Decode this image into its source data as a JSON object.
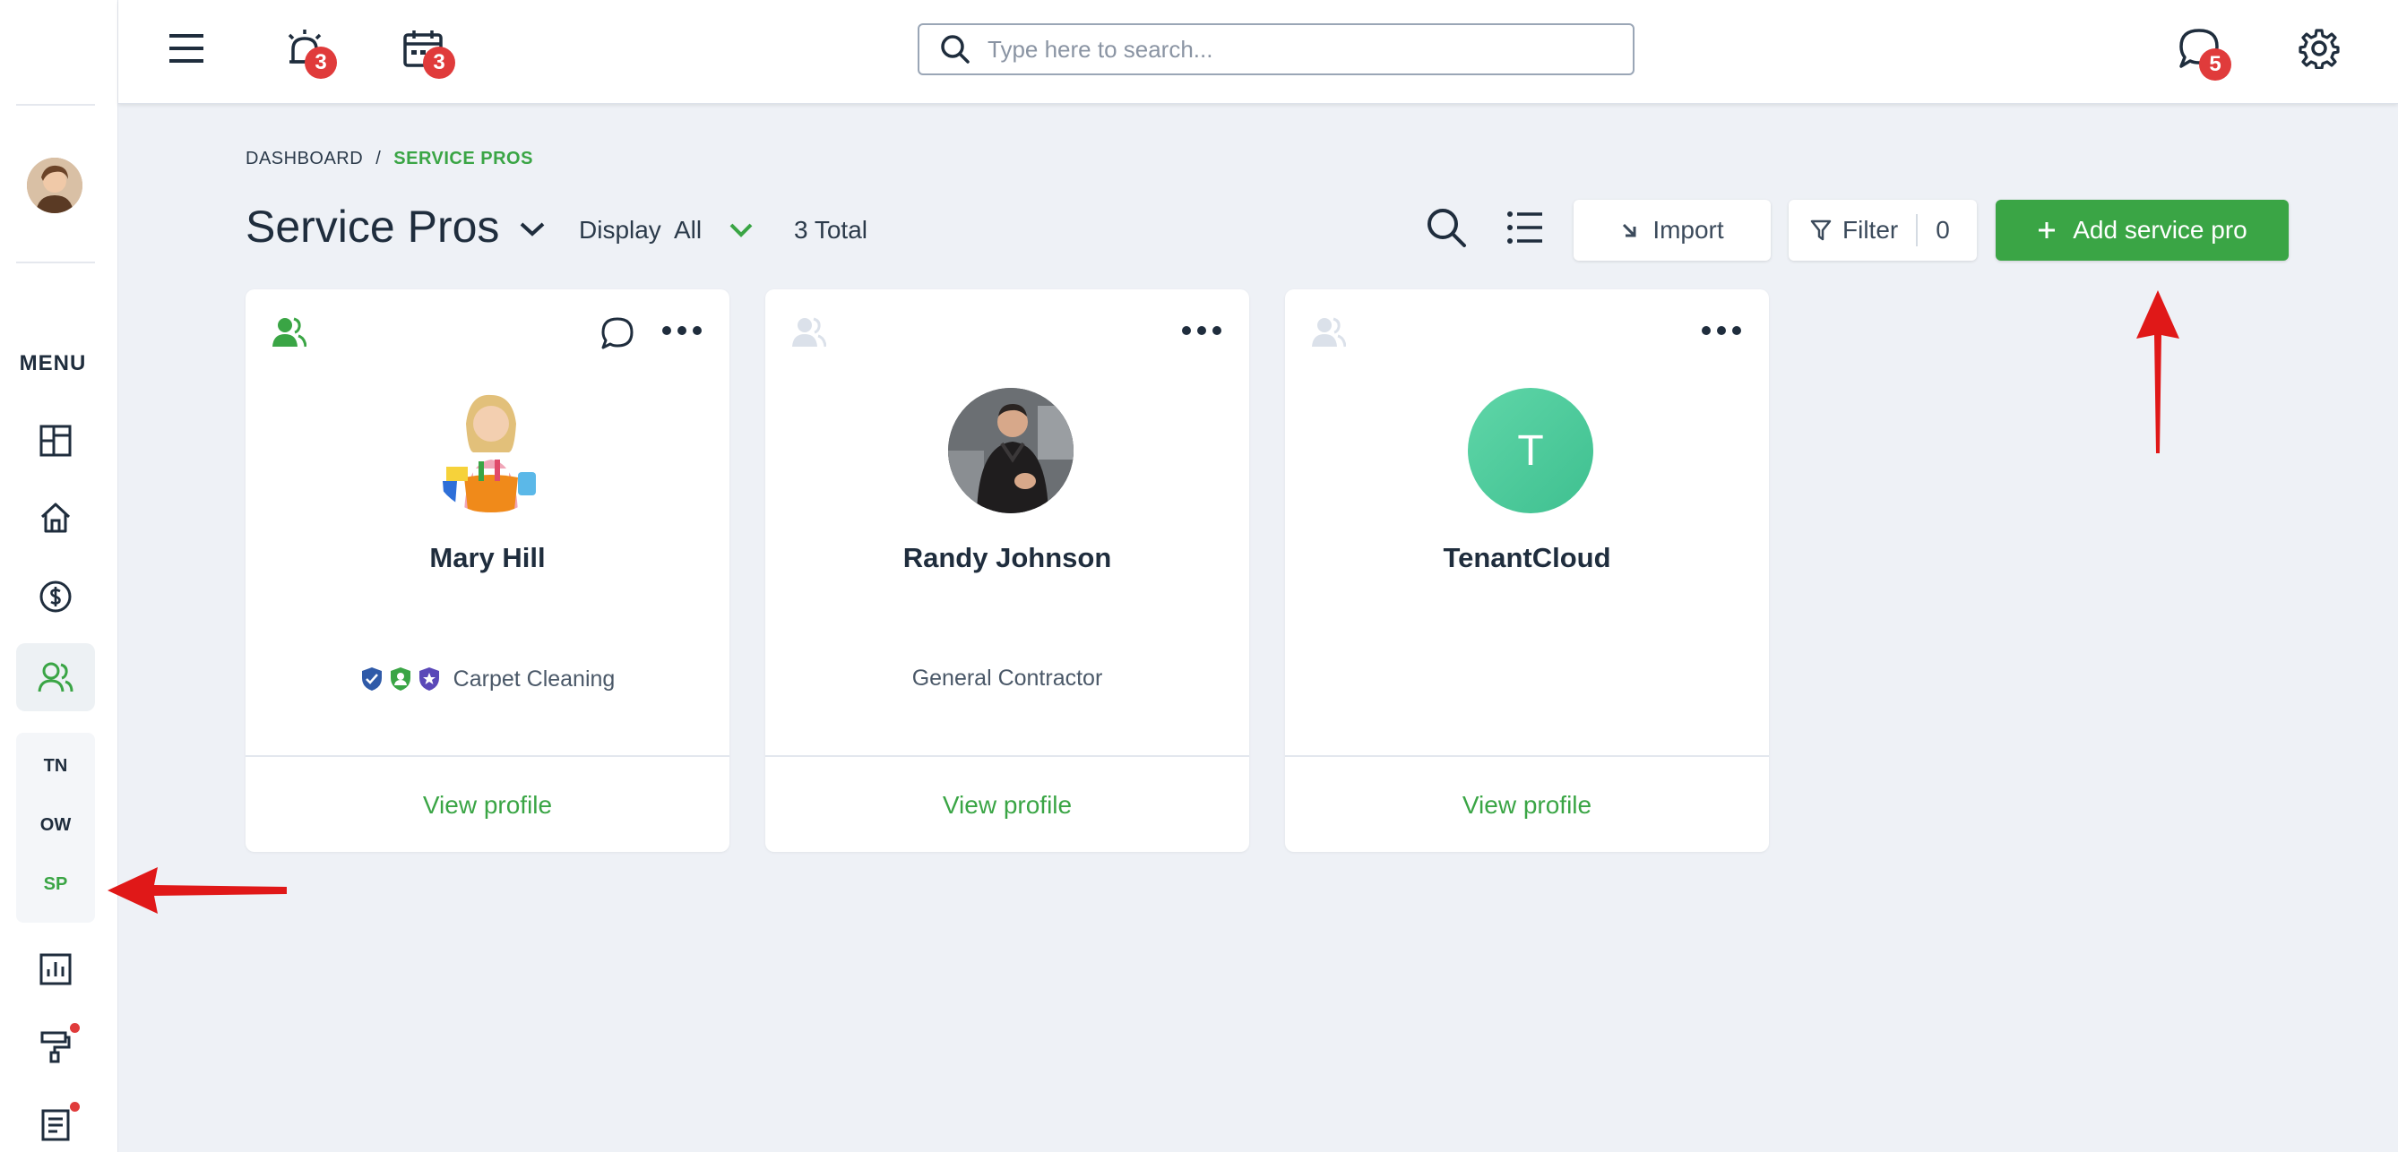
{
  "topbar": {
    "search_placeholder": "Type here to search...",
    "alarm_badge": "3",
    "calendar_badge": "3",
    "chat_badge": "5"
  },
  "sidebar": {
    "menu_label": "MENU",
    "sub_items": [
      {
        "label": "TN"
      },
      {
        "label": "OW"
      },
      {
        "label": "SP",
        "active": true
      }
    ]
  },
  "breadcrumb": {
    "root": "DASHBOARD",
    "separator": "/",
    "current": "SERVICE PROS"
  },
  "header": {
    "title": "Service Pros",
    "display_label": "Display",
    "display_value": "All",
    "total": "3 Total",
    "import_label": "Import",
    "filter_label": "Filter",
    "filter_count": "0",
    "add_label": "Add service pro"
  },
  "cards": [
    {
      "name": "Mary Hill",
      "role": "Carpet Cleaning",
      "link": "View profile"
    },
    {
      "name": "Randy Johnson",
      "role": "General Contractor",
      "link": "View profile"
    },
    {
      "name": "TenantCloud",
      "role": "",
      "initial": "T",
      "link": "View profile"
    }
  ],
  "colors": {
    "accent": "#3aa545",
    "badge": "#e03b3b",
    "annotation_arrow": "#e01818"
  }
}
